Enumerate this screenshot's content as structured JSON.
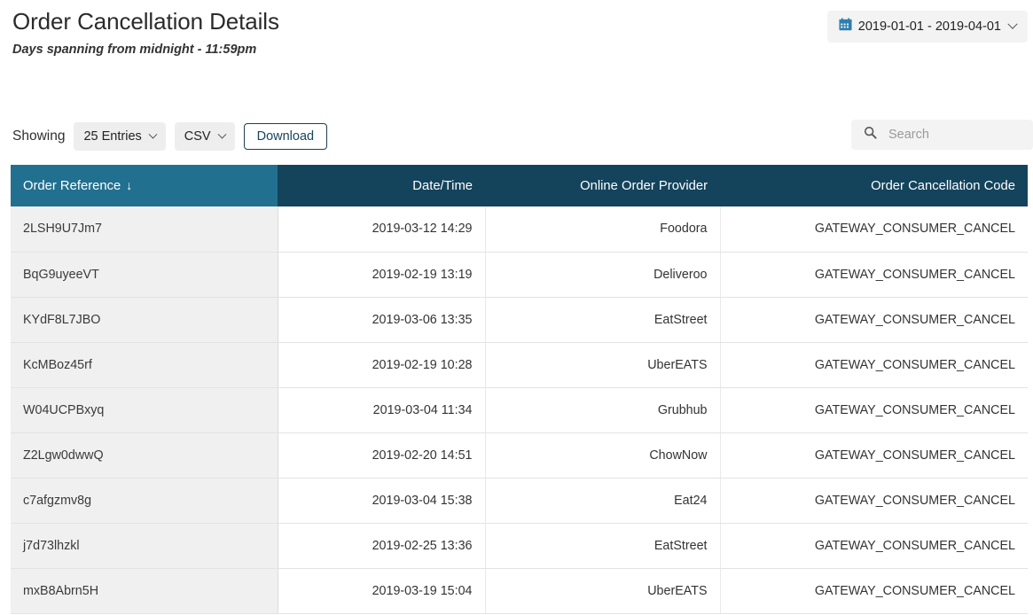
{
  "header": {
    "title": "Order Cancellation Details",
    "subtitle": "Days spanning from midnight - 11:59pm",
    "date_range": {
      "icon": "calendar-icon",
      "label": "2019-01-01 - 2019-04-01",
      "chevron": "chevron-down-icon"
    }
  },
  "toolbar": {
    "showing_label": "Showing",
    "entries_select": "25 Entries",
    "format_select": "CSV",
    "download_label": "Download",
    "search": {
      "icon": "search-icon",
      "placeholder": "Search",
      "value": ""
    }
  },
  "table": {
    "columns": [
      {
        "label": "Order Reference",
        "sorted": true,
        "sort_icon": "↓",
        "align": "left"
      },
      {
        "label": "Date/Time",
        "sorted": false,
        "align": "right"
      },
      {
        "label": "Online Order Provider",
        "sorted": false,
        "align": "right"
      },
      {
        "label": "Order Cancellation Code",
        "sorted": false,
        "align": "right"
      }
    ],
    "rows": [
      {
        "reference": "2LSH9U7Jm7",
        "datetime": "2019-03-12 14:29",
        "provider": "Foodora",
        "code": "GATEWAY_CONSUMER_CANCEL"
      },
      {
        "reference": "BqG9uyeeVT",
        "datetime": "2019-02-19 13:19",
        "provider": "Deliveroo",
        "code": "GATEWAY_CONSUMER_CANCEL"
      },
      {
        "reference": "KYdF8L7JBO",
        "datetime": "2019-03-06 13:35",
        "provider": "EatStreet",
        "code": "GATEWAY_CONSUMER_CANCEL"
      },
      {
        "reference": "KcMBoz45rf",
        "datetime": "2019-02-19 10:28",
        "provider": "UberEATS",
        "code": "GATEWAY_CONSUMER_CANCEL"
      },
      {
        "reference": "W04UCPBxyq",
        "datetime": "2019-03-04 11:34",
        "provider": "Grubhub",
        "code": "GATEWAY_CONSUMER_CANCEL"
      },
      {
        "reference": "Z2Lgw0dwwQ",
        "datetime": "2019-02-20 14:51",
        "provider": "ChowNow",
        "code": "GATEWAY_CONSUMER_CANCEL"
      },
      {
        "reference": "c7afgzmv8g",
        "datetime": "2019-03-04 15:38",
        "provider": "Eat24",
        "code": "GATEWAY_CONSUMER_CANCEL"
      },
      {
        "reference": "j7d73lhzkl",
        "datetime": "2019-02-25 13:36",
        "provider": "EatStreet",
        "code": "GATEWAY_CONSUMER_CANCEL"
      },
      {
        "reference": "mxB8Abrn5H",
        "datetime": "2019-03-19 15:04",
        "provider": "UberEATS",
        "code": "GATEWAY_CONSUMER_CANCEL"
      }
    ]
  },
  "colors": {
    "header_dark": "#14435c",
    "header_sorted": "#22708f",
    "first_column_bg": "#f0f0f0",
    "accent_calendar": "#2e7fae",
    "download_border": "#1d3f54"
  }
}
